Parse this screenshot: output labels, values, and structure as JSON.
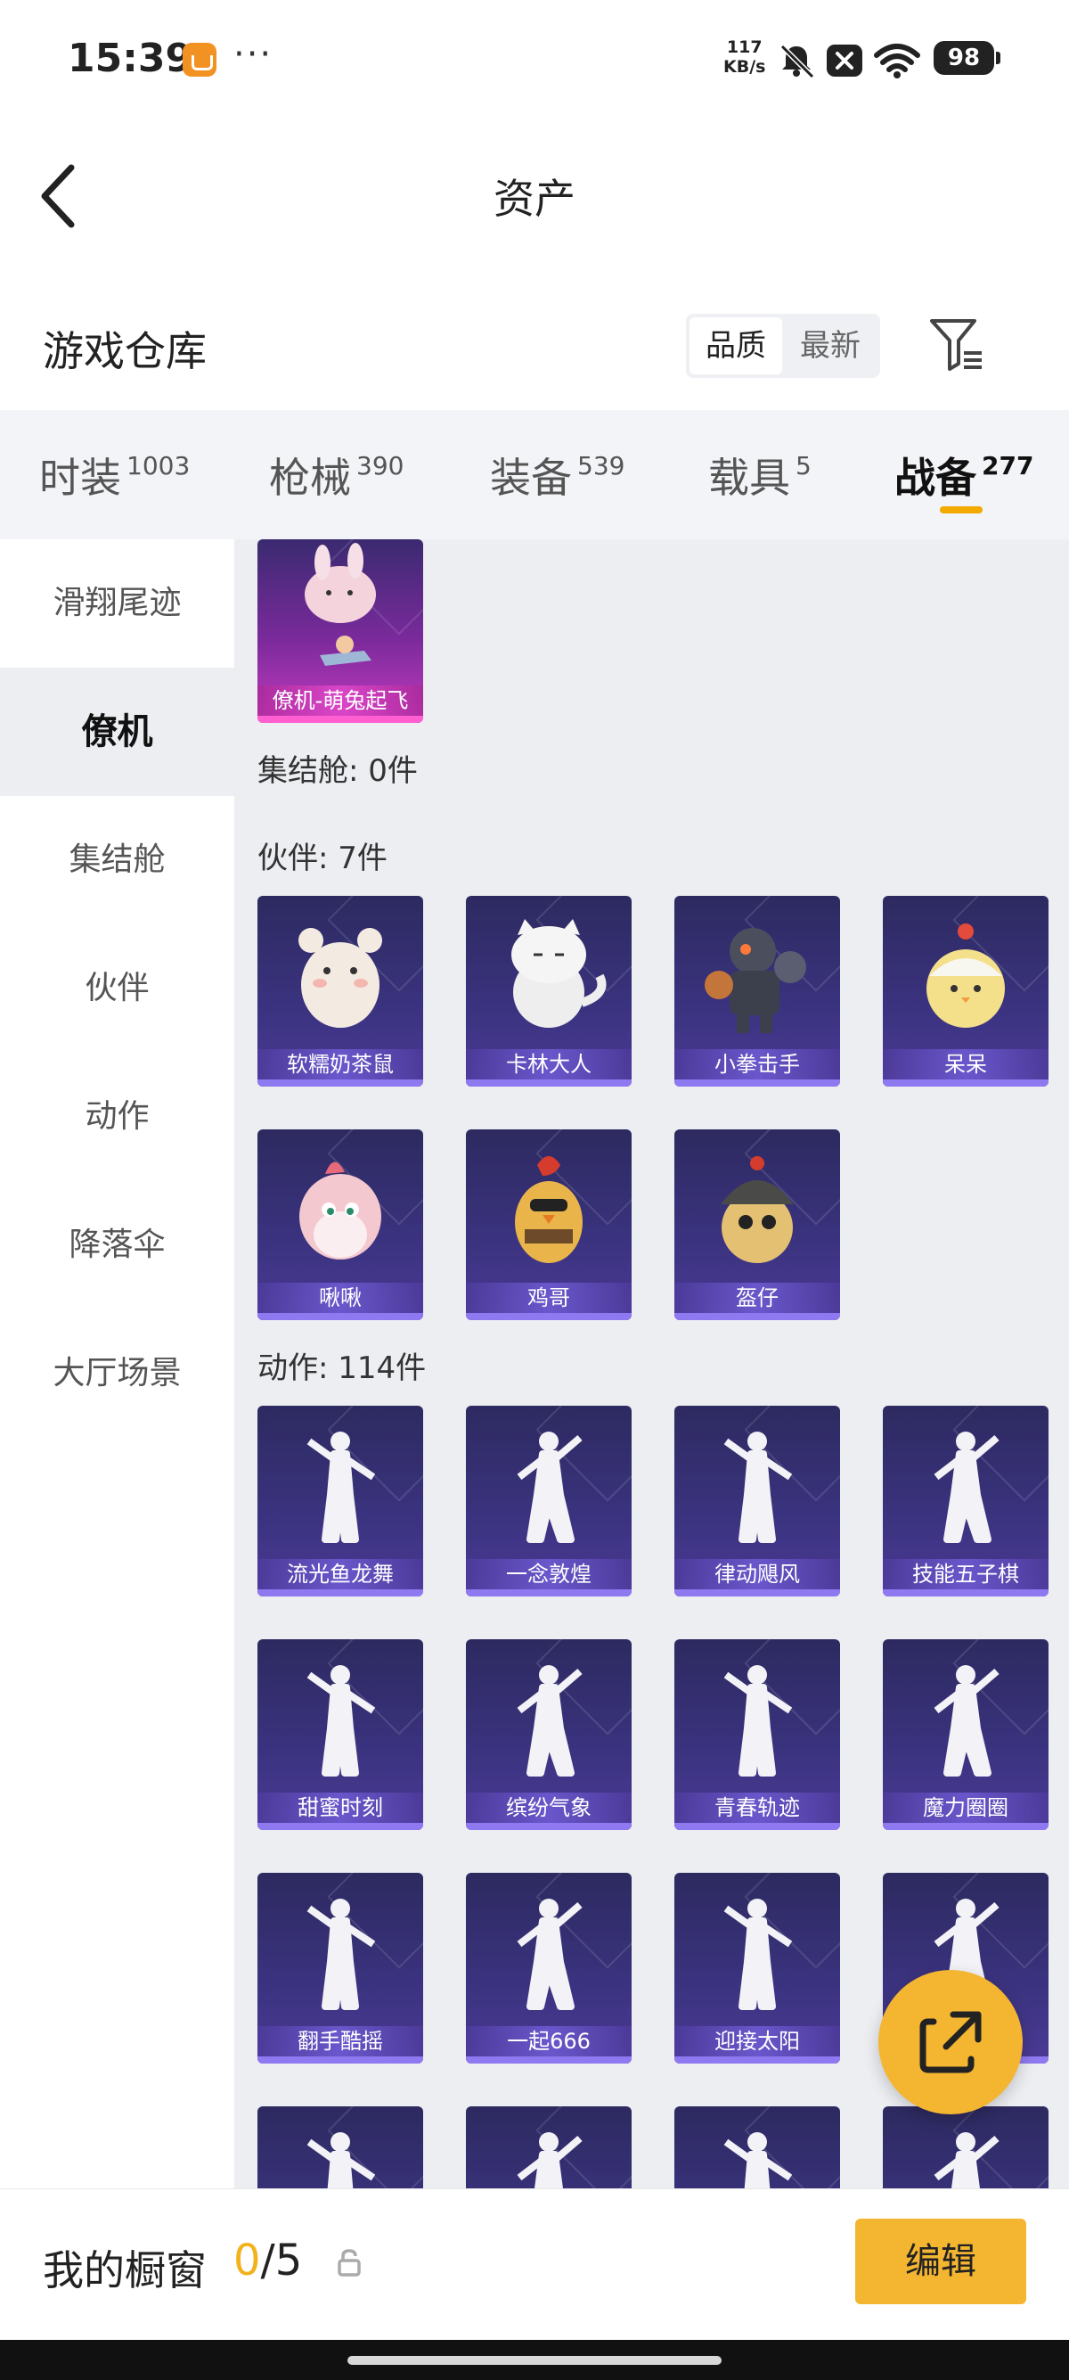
{
  "status_bar": {
    "time": "15:39",
    "dots": "···",
    "net_speed_value": "117",
    "net_speed_unit": "KB/s",
    "battery": "98"
  },
  "nav": {
    "title": "资产"
  },
  "warehouse": {
    "title": "游戏仓库",
    "sort_options": [
      "品质",
      "最新"
    ]
  },
  "tabs": [
    {
      "name": "时装",
      "count": "1003"
    },
    {
      "name": "枪械",
      "count": "390"
    },
    {
      "name": "装备",
      "count": "539"
    },
    {
      "name": "载具",
      "count": "5"
    },
    {
      "name": "战备",
      "count": "277"
    }
  ],
  "sidebar": {
    "items": [
      "滑翔尾迹",
      "僚机",
      "集结舱",
      "伙伴",
      "动作",
      "降落伞",
      "大厅场景"
    ],
    "active_index": 1
  },
  "sections": {
    "wingman_item": "僚机-萌兔起飞",
    "assembly_label": "集结舱: 0件",
    "partner_label": "伙伴: 7件",
    "partners": [
      "软糯奶茶鼠",
      "卡林大人",
      "小拳击手",
      "呆呆",
      "啾啾",
      "鸡哥",
      "盔仔"
    ],
    "action_label": "动作: 114件",
    "actions": [
      "流光鱼龙舞",
      "一念敦煌",
      "律动飓风",
      "技能五子棋",
      "甜蜜时刻",
      "缤纷气象",
      "青春轨迹",
      "魔力圈圈",
      "翻手酷摇",
      "一起666",
      "迎接太阳",
      "",
      "",
      "",
      "",
      ""
    ]
  },
  "bottom": {
    "window_label": "我的橱窗",
    "current": "0",
    "sep_total": "/5",
    "edit_label": "编辑"
  },
  "colors": {
    "accent": "#f4b531",
    "card_bg": "#3b3380",
    "card_bar": "#8f79f0",
    "pink_card_bar": "#ff5fd0"
  }
}
